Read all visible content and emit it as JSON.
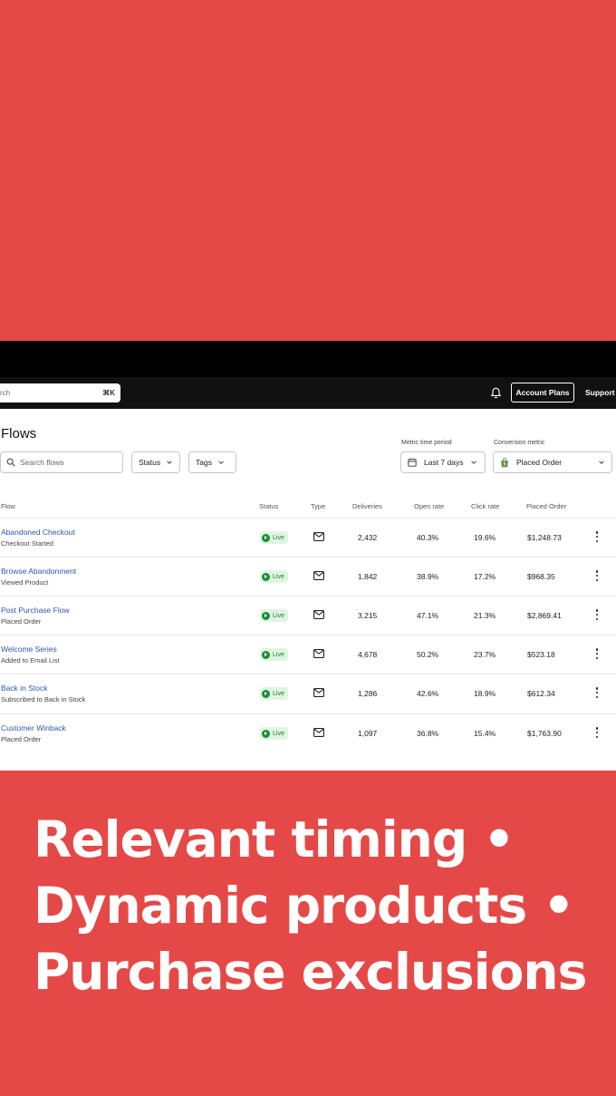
{
  "topbar": {
    "search_text": "rch",
    "search_shortcut": "⌘K",
    "bell_icon": "bell-icon",
    "account_plans": "Account Plans",
    "support": "Support"
  },
  "page": {
    "title": "Flows",
    "search_placeholder": "Search flows",
    "status_filter": "Status",
    "tags_filter": "Tags",
    "metric_time_label": "Metric time period",
    "metric_time_value": "Last 7 days",
    "conversion_label": "Conversion metric",
    "conversion_value": "Placed Order"
  },
  "table": {
    "headers": [
      "Flow",
      "Status",
      "Type",
      "Deliveries",
      "Open rate",
      "Click rate",
      "Placed Order"
    ],
    "rows": [
      {
        "name": "Abandoned Checkout",
        "trigger": "Checkout Started",
        "status": "Live",
        "deliveries": "2,432",
        "open_rate": "40.3%",
        "click_rate": "19.6%",
        "placed_order": "$1,248.73"
      },
      {
        "name": "Browse Abandonment",
        "trigger": "Viewed Product",
        "status": "Live",
        "deliveries": "1,842",
        "open_rate": "38.9%",
        "click_rate": "17.2%",
        "placed_order": "$968.35"
      },
      {
        "name": "Post Purchase Flow",
        "trigger": "Placed Order",
        "status": "Live",
        "deliveries": "3,215",
        "open_rate": "47.1%",
        "click_rate": "21.3%",
        "placed_order": "$2,869.41"
      },
      {
        "name": "Welcome Series",
        "trigger": "Added to Email List",
        "status": "Live",
        "deliveries": "4,678",
        "open_rate": "50.2%",
        "click_rate": "23.7%",
        "placed_order": "$523.18"
      },
      {
        "name": "Back in Stock",
        "trigger": "Subscribed to Back in Stock",
        "status": "Live",
        "deliveries": "1,286",
        "open_rate": "42.6%",
        "click_rate": "18.9%",
        "placed_order": "$612.34"
      },
      {
        "name": "Customer Winback",
        "trigger": "Placed Order",
        "status": "Live",
        "deliveries": "1,097",
        "open_rate": "36.8%",
        "click_rate": "15.4%",
        "placed_order": "$1,763.90"
      }
    ]
  },
  "caption": {
    "line1": "Relevant timing •",
    "line2": "Dynamic products •",
    "line3": "Purchase exclusions"
  },
  "colors": {
    "background_red": "#e54947",
    "link_blue": "#2a5aa3",
    "live_green": "#1f8c3a"
  }
}
